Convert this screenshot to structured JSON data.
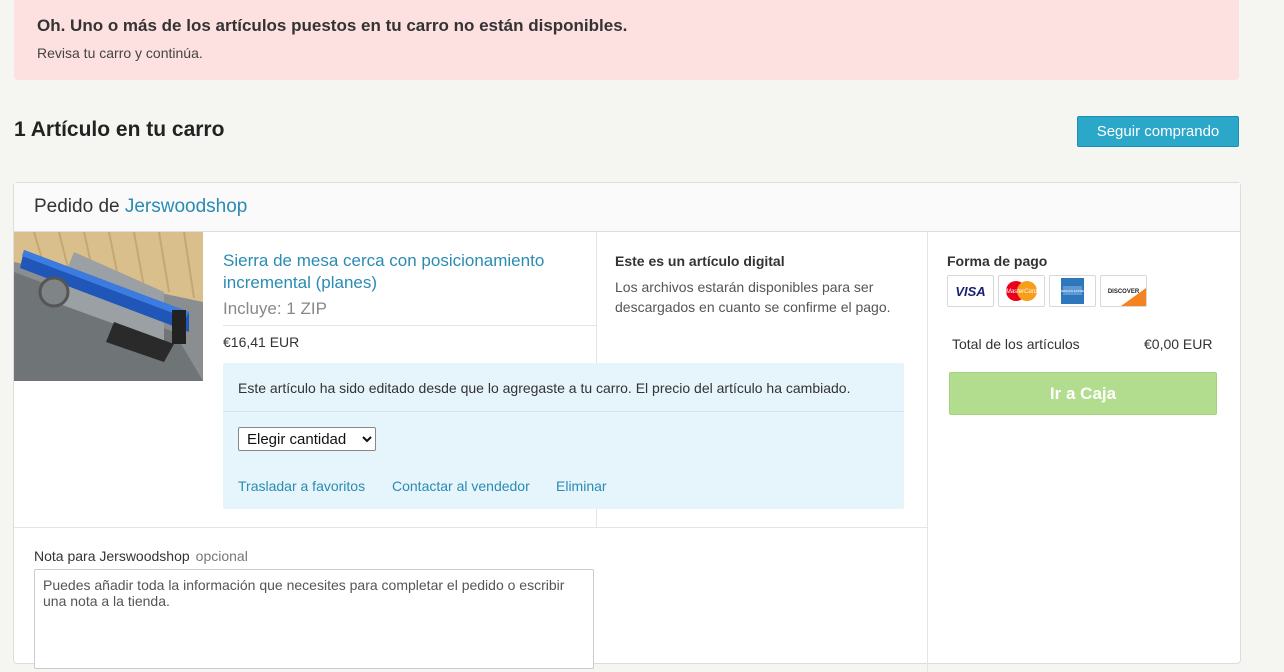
{
  "alert": {
    "title": "Oh. Uno o más de los artículos puestos en tu carro no están disponibles.",
    "subtitle": "Revisa tu carro y continúa."
  },
  "cart": {
    "heading": "1 Artículo en tu carro",
    "keep_shopping_label": "Seguir comprando"
  },
  "order": {
    "prefix": "Pedido de",
    "shop_name": "Jerswoodshop",
    "item": {
      "title": "Sierra de mesa cerca con posicionamiento incremental (planes)",
      "includes": "Incluye: 1 ZIP",
      "price": "€16,41 EUR"
    },
    "digital": {
      "title": "Este es un artículo digital",
      "description": "Los archivos estarán disponibles para ser descargados en cuanto se confirme el pago."
    },
    "notice": {
      "text": "Este artículo ha sido editado desde que lo agregaste a tu carro. El precio del artículo ha cambiado.",
      "quantity_selected": "Elegir cantidad",
      "actions": {
        "move_to_favorites": "Trasladar a favoritos",
        "contact_seller": "Contactar al vendedor",
        "remove": "Eliminar"
      }
    },
    "note": {
      "label": "Nota para Jerswoodshop",
      "optional": "opcional",
      "placeholder": "Puedes añadir toda la información que necesites para completar el pedido o escribir una nota a la tienda."
    }
  },
  "payment": {
    "title": "Forma de pago",
    "cards": [
      {
        "name": "visa-icon",
        "label": "VISA"
      },
      {
        "name": "mastercard-icon",
        "label": "MasterCard"
      },
      {
        "name": "amex-icon",
        "label": "AMERICAN EXPRESS"
      },
      {
        "name": "discover-icon",
        "label": "DISCOVER"
      }
    ],
    "total_label": "Total de los artículos",
    "total_value": "€0,00 EUR",
    "checkout_label": "Ir a Caja"
  },
  "colors": {
    "alert_bg": "#fde0e0",
    "accent_link": "#2a8bb3",
    "primary_button": "#2aa7c9",
    "checkout_button": "#b3dd8e",
    "notice_bg": "#e6f4fb",
    "page_bg": "#f5f5f1"
  }
}
